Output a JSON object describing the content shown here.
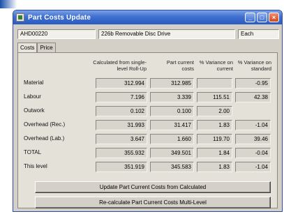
{
  "window": {
    "title": "Part Costs Update"
  },
  "header": {
    "part_number": "AHD00220",
    "description": "226b Removable Disc Drive",
    "unit": "Each"
  },
  "tabs": [
    "Costs",
    "Price"
  ],
  "table": {
    "columns": [
      "Calculated from single-level Roll-Up",
      "Part current costs",
      "% Variance on current",
      "% Variance on standard"
    ],
    "rows": [
      {
        "label": "Material",
        "calc": "312.994",
        "current": "312.985",
        "var_current": "",
        "var_standard": "-0.95"
      },
      {
        "label": "Labour",
        "calc": "7.196",
        "current": "3.339",
        "var_current": "115.51",
        "var_standard": "42.38"
      },
      {
        "label": "Outwork",
        "calc": "0.102",
        "current": "0.100",
        "var_current": "2.00",
        "var_standard": ""
      },
      {
        "label": "Overhead (Rec.)",
        "calc": "31.993",
        "current": "31.417",
        "var_current": "1.83",
        "var_standard": "-1.04"
      },
      {
        "label": "Overhead (Lab.)",
        "calc": "3.647",
        "current": "1.660",
        "var_current": "119.70",
        "var_standard": "39.46"
      },
      {
        "label": "TOTAL",
        "calc": "355.932",
        "current": "349.501",
        "var_current": "1.84",
        "var_standard": "-0.04"
      },
      {
        "label": "This level",
        "calc": "351.919",
        "current": "345.583",
        "var_current": "1.83",
        "var_standard": "-1.04"
      }
    ]
  },
  "buttons": {
    "update": "Update Part Current Costs from Calculated",
    "recalc": "Re-calculate Part Current Costs Multi-Level"
  }
}
